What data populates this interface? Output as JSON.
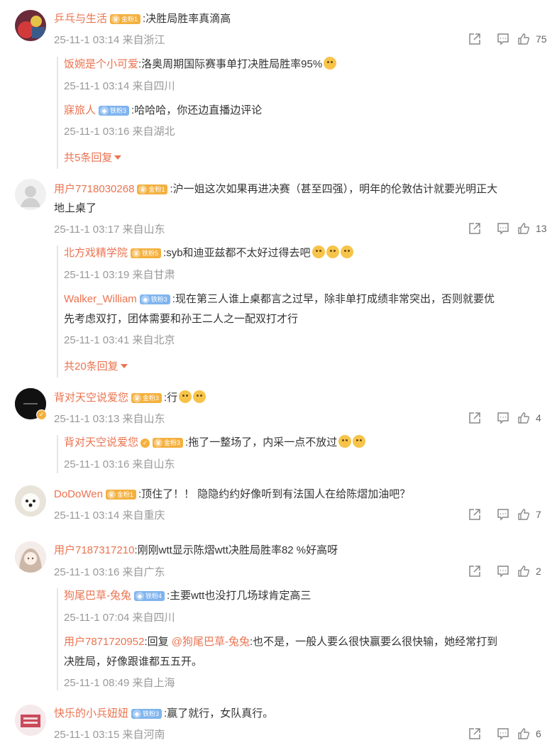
{
  "comments": [
    {
      "user": "乒乓与生活",
      "badge": "金粉1",
      "text": ":决胜局胜率真滴高",
      "meta": "25-11-1 03:14 来自浙江",
      "likes": "75",
      "replies": [
        {
          "user": "饭婉是个小可爱",
          "badge": "",
          "text": ":洛奥周期国际赛事单打决胜局胜率95%",
          "meta": "25-11-1 03:14 来自四川"
        },
        {
          "user": "寐旅人",
          "badge": "铁粉3",
          "text": ":哈哈哈，你还边直播边评论",
          "meta": "25-11-1 03:16 来自湖北"
        }
      ],
      "more": "共5条回复"
    },
    {
      "user": "用户7718030268",
      "badge": "金粉1",
      "text": ":沪一姐这次如果再进决赛（甚至四强），明年的伦敦估计就要光明正大",
      "text2": "地上桌了",
      "meta": "25-11-1 03:17 来自山东",
      "likes": "13",
      "replies": [
        {
          "user": "北方戏精学院",
          "badge": "铁粉5",
          "text": ":syb和迪亚兹都不太好过得去吧",
          "meta": "25-11-1 03:19 来自甘肃"
        },
        {
          "user": "Walker_William",
          "badge": "铁粉3",
          "text": ":现在第三人谁上桌都言之过早，除非单打成绩非常突出，否则就要优",
          "text2": "先考虑双打，团体需要和孙王二人之一配双打才行",
          "meta": "25-11-1 03:41 来自北京"
        }
      ],
      "more": "共20条回复"
    },
    {
      "user": "背对天空说爱您",
      "badge": "金粉3",
      "text": ":行",
      "meta": "25-11-1 03:13 来自山东",
      "likes": "4",
      "replies": [
        {
          "user": "背对天空说爱您",
          "badge": "金粉3",
          "text": ":拖了一整场了，内采一点不放过",
          "meta": "25-11-1 03:16 来自山东"
        }
      ]
    },
    {
      "user": "DoDoWen",
      "badge": "金粉1",
      "text": ":顶住了！！ 隐隐约约好像听到有法国人在给陈熠加油吧？",
      "meta": "25-11-1 03:14 来自重庆",
      "likes": "7"
    },
    {
      "user": "用户7187317210",
      "badge": "",
      "text": ":刚刚wtt显示陈熠wtt决胜局胜率82 %好高呀",
      "meta": "25-11-1 03:16 来自广东",
      "likes": "2",
      "replies": [
        {
          "user": "狗尾巴草-兔兔",
          "badge": "铁粉4",
          "text": ":主要wtt也没打几场球肯定高三",
          "meta": "25-11-1 07:04 来自四川"
        },
        {
          "user": "用户7871720952",
          "badge": "",
          "text": ":回复 ",
          "mention": "@狗尾巴草-兔兔",
          "text_after": ":也不是，一般人要么很快赢要么很快输，她经常打到",
          "text2": "决胜局，好像跟谁都五五开。",
          "meta": "25-11-1 08:49 来自上海"
        }
      ]
    },
    {
      "user": "快乐的小兵妞妞",
      "badge": "铁粉3",
      "text": ":赢了就行，女队真行。",
      "meta": "25-11-1 03:15 来自河南",
      "likes": "6"
    }
  ],
  "colors": {
    "username": "#eb7350",
    "meta": "#999999",
    "gold_badge": "#f4b03e",
    "iron_badge": "#7fb4ee"
  }
}
